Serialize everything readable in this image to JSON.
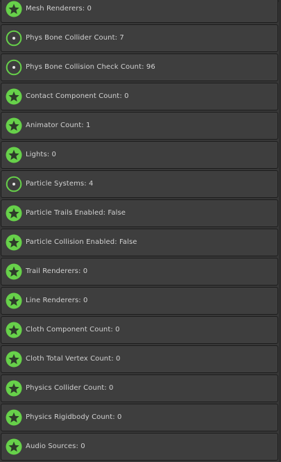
{
  "colors": {
    "good": "#67d14a",
    "medium": "#67d14a",
    "row_bg": "#3e3e3e",
    "text": "#d2d2d2"
  },
  "stats": {
    "items": [
      {
        "label": "Mesh Renderers: 0",
        "icon": "star-icon"
      },
      {
        "label": "Phys Bone Collider Count: 7",
        "icon": "circle-icon"
      },
      {
        "label": "Phys Bone Collision Check Count: 96",
        "icon": "circle-icon"
      },
      {
        "label": "Contact Component Count: 0",
        "icon": "star-icon"
      },
      {
        "label": "Animator Count: 1",
        "icon": "star-icon"
      },
      {
        "label": "Lights: 0",
        "icon": "star-icon"
      },
      {
        "label": "Particle Systems: 4",
        "icon": "circle-icon"
      },
      {
        "label": "Particle Trails Enabled: False",
        "icon": "star-icon"
      },
      {
        "label": "Particle Collision Enabled: False",
        "icon": "star-icon"
      },
      {
        "label": "Trail Renderers: 0",
        "icon": "star-icon"
      },
      {
        "label": "Line Renderers: 0",
        "icon": "star-icon"
      },
      {
        "label": "Cloth Component Count: 0",
        "icon": "star-icon"
      },
      {
        "label": "Cloth Total Vertex Count: 0",
        "icon": "star-icon"
      },
      {
        "label": "Physics Collider Count: 0",
        "icon": "star-icon"
      },
      {
        "label": "Physics Rigidbody Count: 0",
        "icon": "star-icon"
      },
      {
        "label": "Audio Sources: 0",
        "icon": "star-icon"
      }
    ]
  }
}
